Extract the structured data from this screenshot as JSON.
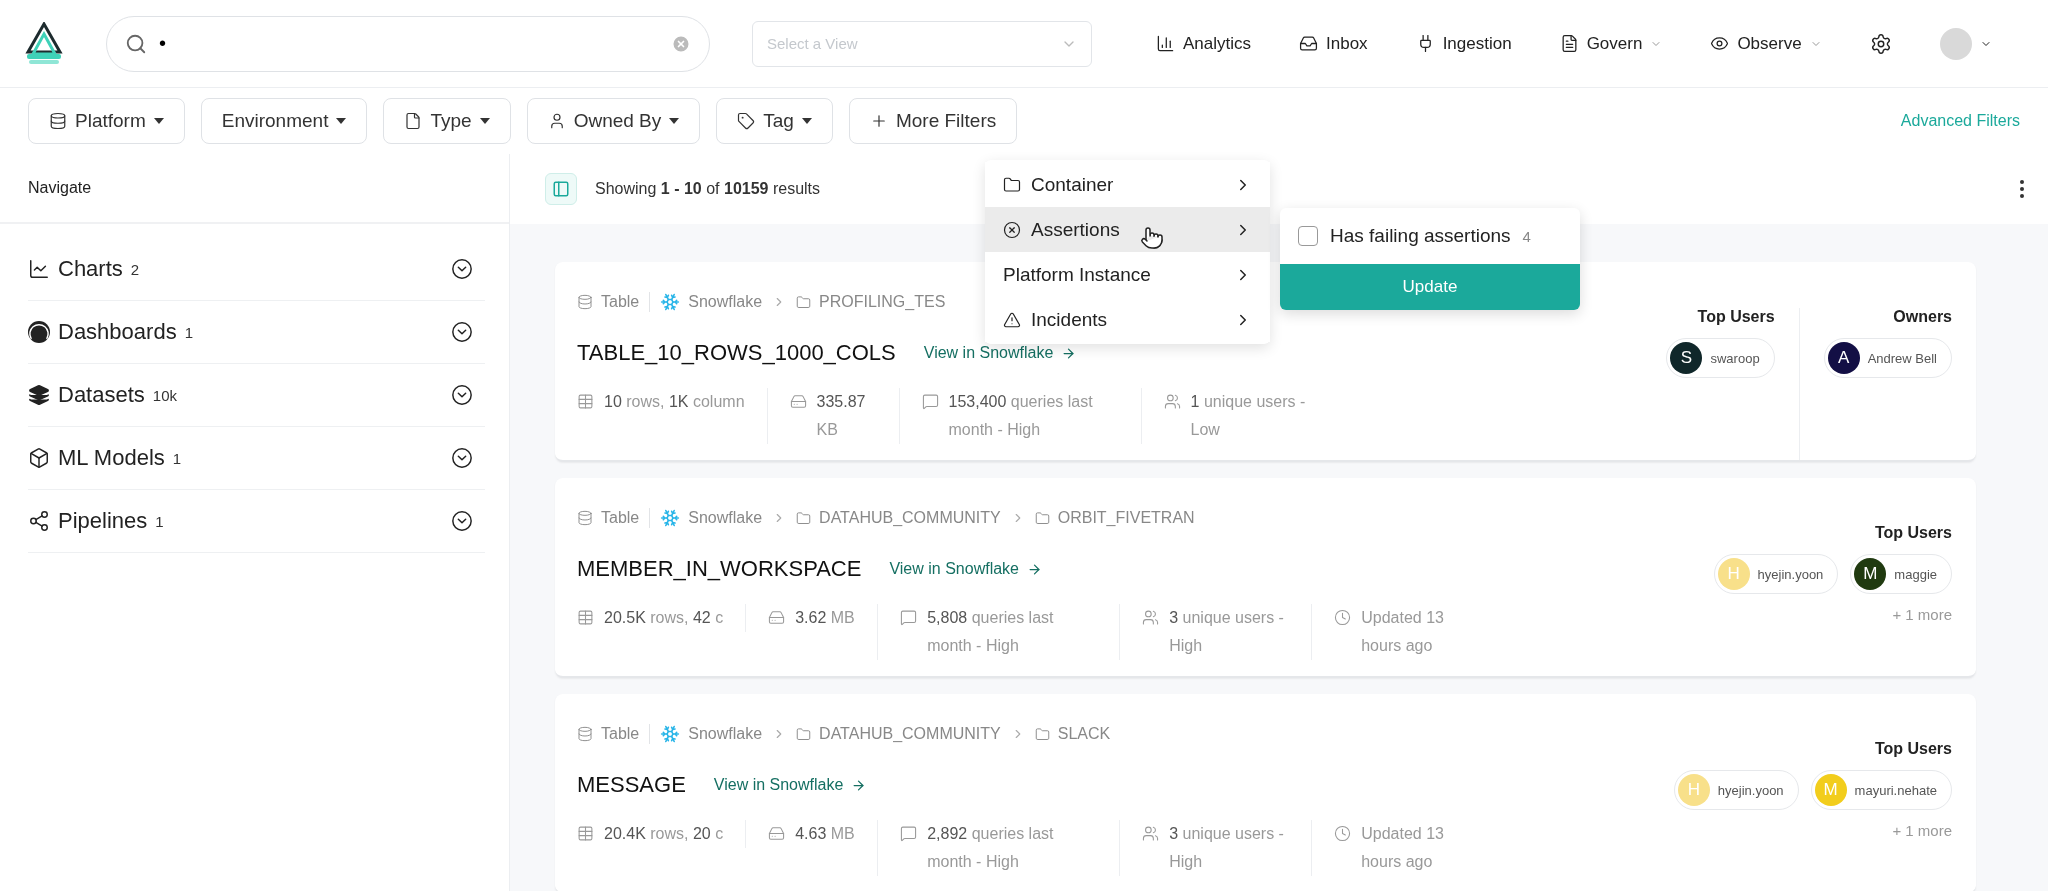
{
  "header": {
    "search": {
      "value": "•"
    },
    "view_select": {
      "placeholder": "Select a View"
    },
    "nav": [
      {
        "label": "Analytics",
        "dropdown": false
      },
      {
        "label": "Inbox",
        "dropdown": false
      },
      {
        "label": "Ingestion",
        "dropdown": false
      },
      {
        "label": "Govern",
        "dropdown": true
      },
      {
        "label": "Observe",
        "dropdown": true
      }
    ]
  },
  "filters": [
    {
      "label": "Platform",
      "dropdown": true
    },
    {
      "label": "Environment",
      "dropdown": true
    },
    {
      "label": "Type",
      "dropdown": true
    },
    {
      "label": "Owned By",
      "dropdown": true
    },
    {
      "label": "Tag",
      "dropdown": true
    },
    {
      "label": "More Filters",
      "dropdown": false
    }
  ],
  "advanced_filters": "Advanced Filters",
  "sidebar": {
    "title": "Navigate",
    "items": [
      {
        "label": "Charts",
        "count": "2"
      },
      {
        "label": "Dashboards",
        "count": "1"
      },
      {
        "label": "Datasets",
        "count": "10k"
      },
      {
        "label": "ML Models",
        "count": "1"
      },
      {
        "label": "Pipelines",
        "count": "1"
      }
    ]
  },
  "results": {
    "summary": "Showing **1 - 10** of **10159** results",
    "cards": [
      {
        "type": "Table",
        "platform": "Snowflake",
        "path": [
          "PROFILING_TES"
        ],
        "name": "TABLE_10_ROWS_1000_COLS",
        "link": "View in Snowflake",
        "stats": [
          {
            "kind": "rows",
            "text": "**10** rows, **1K** column"
          },
          {
            "kind": "size",
            "text": "**335.87** KB"
          },
          {
            "kind": "queries",
            "text": "**153,400** queries last month - High"
          },
          {
            "kind": "users",
            "text": "**1** unique users - Low"
          }
        ],
        "people": [
          {
            "title": "Top Users",
            "users": [
              {
                "initial": "S",
                "name": "swaroop",
                "color": "#10272a"
              }
            ]
          },
          {
            "title": "Owners",
            "users": [
              {
                "initial": "A",
                "name": "Andrew Bell",
                "color": "#130f45"
              }
            ]
          }
        ]
      },
      {
        "type": "Table",
        "platform": "Snowflake",
        "path": [
          "DATAHUB_COMMUNITY",
          "ORBIT_FIVETRAN"
        ],
        "name": "MEMBER_IN_WORKSPACE",
        "link": "View in Snowflake",
        "stats": [
          {
            "kind": "rows",
            "text": "**20.5K** rows, **42** c"
          },
          {
            "kind": "size",
            "text": "**3.62** MB"
          },
          {
            "kind": "queries",
            "text": "**5,808** queries last month - High"
          },
          {
            "kind": "users",
            "text": "**3** unique users - High"
          },
          {
            "kind": "updated",
            "text": "Updated 13 hours ago"
          }
        ],
        "people": [
          {
            "title": "Top Users",
            "users": [
              {
                "initial": "H",
                "name": "hyejin.yoon",
                "color": "#f8e08a"
              },
              {
                "initial": "M",
                "name": "maggie",
                "color": "#203a10"
              }
            ],
            "more": "+ 1 more"
          }
        ]
      },
      {
        "type": "Table",
        "platform": "Snowflake",
        "path": [
          "DATAHUB_COMMUNITY",
          "SLACK"
        ],
        "name": "MESSAGE",
        "link": "View in Snowflake",
        "stats": [
          {
            "kind": "rows",
            "text": "**20.4K** rows, **20** c"
          },
          {
            "kind": "size",
            "text": "**4.63** MB"
          },
          {
            "kind": "queries",
            "text": "**2,892** queries last month - High"
          },
          {
            "kind": "users",
            "text": "**3** unique users - High"
          },
          {
            "kind": "updated",
            "text": "Updated 13 hours ago"
          }
        ],
        "people": [
          {
            "title": "Top Users",
            "users": [
              {
                "initial": "H",
                "name": "hyejin.yoon",
                "color": "#f8e08a"
              },
              {
                "initial": "M",
                "name": "mayuri.nehate",
                "color": "#f2cd1c"
              }
            ],
            "more": "+ 1 more"
          }
        ]
      }
    ]
  },
  "more_filters_menu": {
    "items": [
      {
        "label": "Container",
        "selected": false
      },
      {
        "label": "Assertions",
        "selected": true
      },
      {
        "label": "Platform Instance",
        "selected": false
      },
      {
        "label": "Incidents",
        "selected": false
      }
    ],
    "submenu": {
      "options": [
        {
          "label": "Has failing assertions",
          "count": "4",
          "checked": false
        }
      ],
      "button": "Update"
    }
  }
}
